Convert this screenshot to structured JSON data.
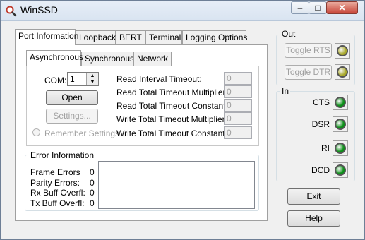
{
  "window": {
    "title": "WinSSD"
  },
  "tabs": [
    {
      "label": "Port Information",
      "active": true
    },
    {
      "label": "Loopback"
    },
    {
      "label": "BERT"
    },
    {
      "label": "Terminal"
    },
    {
      "label": "Logging Options"
    }
  ],
  "subtabs": [
    {
      "label": "Asynchronous",
      "active": true
    },
    {
      "label": "Synchronous"
    },
    {
      "label": "Network"
    }
  ],
  "com": {
    "label": "COM:",
    "value": "1"
  },
  "buttons": {
    "open": "Open",
    "settings": "Settings...",
    "exit": "Exit",
    "help": "Help"
  },
  "remember": {
    "label": "Remember Settings"
  },
  "timeouts": [
    {
      "label": "Read Interval Timeout:",
      "value": "0"
    },
    {
      "label": "Read Total Timeout Multiplier:",
      "value": "0"
    },
    {
      "label": "Read Total Timeout Constant:",
      "value": "0"
    },
    {
      "label": "Write Total Timeout Multiplier:",
      "value": "0"
    },
    {
      "label": "Write Total Timeout Constant:",
      "value": "0"
    }
  ],
  "errors": {
    "title": "Error Information",
    "items": [
      {
        "label": "Frame Errors",
        "value": "0"
      },
      {
        "label": "Parity Errors:",
        "value": "0"
      },
      {
        "label": "Rx Buff Overfl:",
        "value": "0"
      },
      {
        "label": "Tx Buff Overfl:",
        "value": "0"
      }
    ]
  },
  "out": {
    "title": "Out",
    "controls": [
      {
        "label": "Toggle RTS",
        "led_color": "#a8a82a"
      },
      {
        "label": "Toggle DTR",
        "led_color": "#a8a82a"
      }
    ]
  },
  "in": {
    "title": "In",
    "signals": [
      {
        "label": "CTS",
        "led_color": "#0b8f17"
      },
      {
        "label": "DSR",
        "led_color": "#0b8f17"
      },
      {
        "label": "RI",
        "led_color": "#0b8f17"
      },
      {
        "label": "DCD",
        "led_color": "#0b8f17"
      }
    ]
  }
}
